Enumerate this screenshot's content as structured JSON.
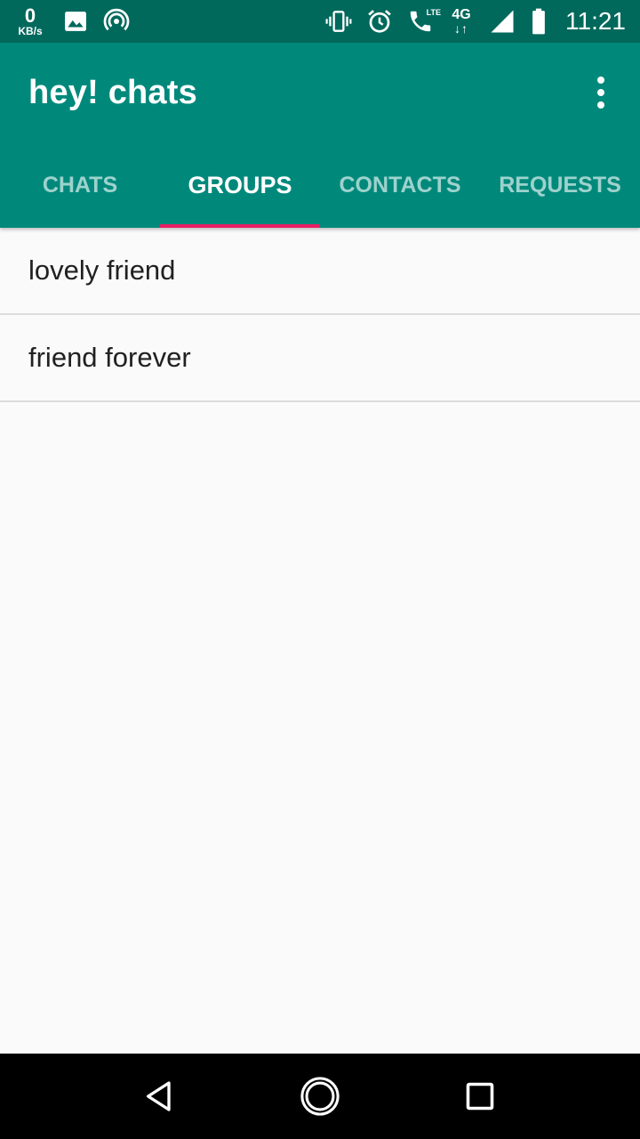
{
  "status_bar": {
    "net_speed_value": "0",
    "net_speed_unit": "KB/s",
    "network_type": "4G",
    "network_arrows": "↓↑",
    "lte_label": "LTE",
    "time": "11:21",
    "icons": [
      "image-icon",
      "hotspot-icon",
      "vibrate-icon",
      "alarm-icon",
      "volte-call-icon",
      "signal-icon",
      "battery-icon"
    ]
  },
  "app_bar": {
    "title": "hey! chats",
    "menu_icon": "overflow-menu-icon"
  },
  "tabs": [
    {
      "label": "CHATS",
      "active": false
    },
    {
      "label": "GROUPS",
      "active": true
    },
    {
      "label": "CONTACTS",
      "active": false
    },
    {
      "label": "REQUESTS",
      "active": false
    }
  ],
  "groups": [
    {
      "name": "lovely friend"
    },
    {
      "name": "friend forever"
    }
  ],
  "nav_bar": {
    "icons": [
      "back-icon",
      "home-icon",
      "recents-icon"
    ]
  },
  "colors": {
    "status_bar": "#00695c",
    "primary": "#00897b",
    "tab_indicator": "#e91e63",
    "background": "#fafafa",
    "text": "#212121"
  }
}
